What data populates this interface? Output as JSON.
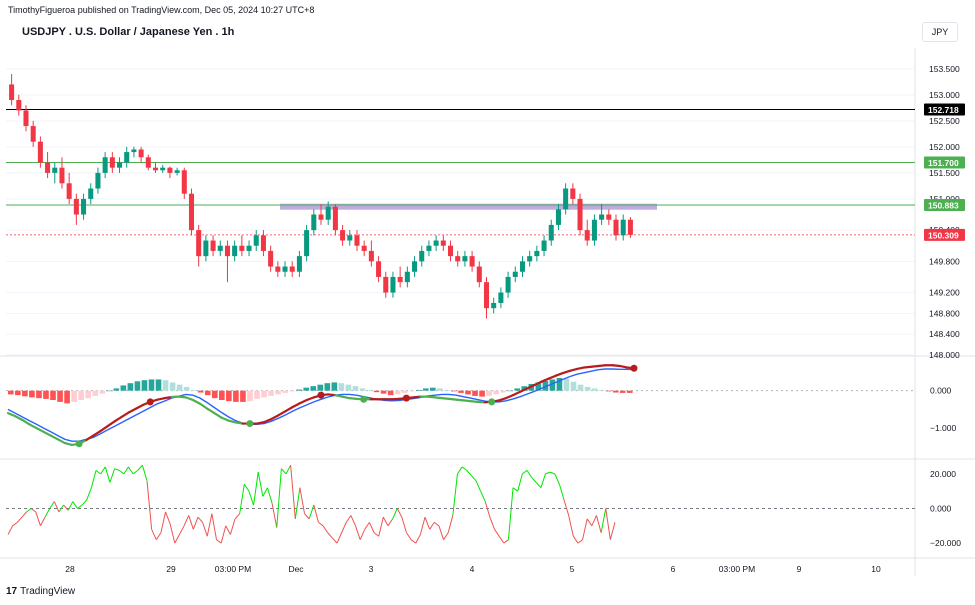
{
  "header": {
    "publisher": "TimothyFigueroa published on TradingView.com, Dec 05, 2024 10:27 UTC+8",
    "title": "USDJPY . U.S. Dollar / Japanese Yen . 1h",
    "currency": "JPY"
  },
  "footer": {
    "logo_glyph": "17",
    "logo_text": "TradingView"
  },
  "colors": {
    "up": "#089981",
    "down": "#f23645",
    "purple_zone": "#b39ddb",
    "green_line": "#4caf50",
    "black_line": "#000000",
    "price_line": "#f23645",
    "macd_line": "#2962ff",
    "signal_line_up": "#4caf50",
    "signal_line_down": "#b71c1c",
    "rsi_up": "#00e600",
    "rsi_down": "#ef5350"
  },
  "chart_data": {
    "type": "candlestick",
    "x_labels": [
      "28",
      "29",
      "03:00 PM",
      "Dec",
      "3",
      "4",
      "5",
      "6",
      "03:00 PM",
      "9",
      "10"
    ],
    "price_axis": {
      "ticks": [
        "153.500",
        "153.000",
        "152.500",
        "152.000",
        "151.500",
        "151.000",
        "150.400",
        "149.800",
        "149.200",
        "148.800",
        "148.400",
        "148.000"
      ],
      "range": [
        148.0,
        153.9
      ]
    },
    "horizontal_levels": [
      {
        "label": "152.718",
        "value": 152.718,
        "kind": "black"
      },
      {
        "label": "151.700",
        "value": 151.7,
        "kind": "green"
      },
      {
        "label": "150.883",
        "value": 150.883,
        "kind": "green"
      },
      {
        "label": "150.309",
        "value": 150.309,
        "kind": "price"
      }
    ],
    "resistance_zone": {
      "from_x": "Dec 2 ~02:00",
      "to_x": "Dec 5 ~20:00",
      "value": 150.85
    },
    "candles": [
      {
        "o": 153.2,
        "h": 153.4,
        "l": 152.8,
        "c": 152.9
      },
      {
        "o": 152.9,
        "h": 153.0,
        "l": 152.6,
        "c": 152.7
      },
      {
        "o": 152.7,
        "h": 152.8,
        "l": 152.3,
        "c": 152.4
      },
      {
        "o": 152.4,
        "h": 152.5,
        "l": 152.0,
        "c": 152.1
      },
      {
        "o": 152.1,
        "h": 152.2,
        "l": 151.6,
        "c": 151.7
      },
      {
        "o": 151.7,
        "h": 151.9,
        "l": 151.4,
        "c": 151.5
      },
      {
        "o": 151.5,
        "h": 151.7,
        "l": 151.3,
        "c": 151.6
      },
      {
        "o": 151.6,
        "h": 151.8,
        "l": 151.2,
        "c": 151.3
      },
      {
        "o": 151.3,
        "h": 151.5,
        "l": 150.9,
        "c": 151.0
      },
      {
        "o": 151.0,
        "h": 151.1,
        "l": 150.5,
        "c": 150.7
      },
      {
        "o": 150.7,
        "h": 151.1,
        "l": 150.6,
        "c": 151.0
      },
      {
        "o": 151.0,
        "h": 151.3,
        "l": 150.9,
        "c": 151.2
      },
      {
        "o": 151.2,
        "h": 151.6,
        "l": 151.1,
        "c": 151.5
      },
      {
        "o": 151.5,
        "h": 151.9,
        "l": 151.4,
        "c": 151.8
      },
      {
        "o": 151.8,
        "h": 151.9,
        "l": 151.5,
        "c": 151.6
      },
      {
        "o": 151.6,
        "h": 151.8,
        "l": 151.5,
        "c": 151.7
      },
      {
        "o": 151.7,
        "h": 152.0,
        "l": 151.6,
        "c": 151.9
      },
      {
        "o": 151.9,
        "h": 152.0,
        "l": 151.8,
        "c": 151.95
      },
      {
        "o": 151.95,
        "h": 152.0,
        "l": 151.7,
        "c": 151.8
      },
      {
        "o": 151.8,
        "h": 151.85,
        "l": 151.55,
        "c": 151.6
      },
      {
        "o": 151.6,
        "h": 151.7,
        "l": 151.5,
        "c": 151.55
      },
      {
        "o": 151.55,
        "h": 151.65,
        "l": 151.5,
        "c": 151.6
      },
      {
        "o": 151.6,
        "h": 151.62,
        "l": 151.4,
        "c": 151.5
      },
      {
        "o": 151.5,
        "h": 151.6,
        "l": 151.45,
        "c": 151.55
      },
      {
        "o": 151.55,
        "h": 151.6,
        "l": 151.0,
        "c": 151.1
      },
      {
        "o": 151.1,
        "h": 151.2,
        "l": 150.3,
        "c": 150.4
      },
      {
        "o": 150.4,
        "h": 150.5,
        "l": 149.7,
        "c": 149.9
      },
      {
        "o": 149.9,
        "h": 150.3,
        "l": 149.8,
        "c": 150.2
      },
      {
        "o": 150.2,
        "h": 150.3,
        "l": 149.9,
        "c": 150.0
      },
      {
        "o": 150.0,
        "h": 150.2,
        "l": 149.9,
        "c": 150.1
      },
      {
        "o": 150.1,
        "h": 150.2,
        "l": 149.4,
        "c": 149.9
      },
      {
        "o": 149.9,
        "h": 150.2,
        "l": 149.8,
        "c": 150.1
      },
      {
        "o": 150.1,
        "h": 150.3,
        "l": 149.9,
        "c": 150.0
      },
      {
        "o": 150.0,
        "h": 150.2,
        "l": 149.9,
        "c": 150.1
      },
      {
        "o": 150.1,
        "h": 150.4,
        "l": 150.0,
        "c": 150.3
      },
      {
        "o": 150.3,
        "h": 150.4,
        "l": 149.9,
        "c": 150.0
      },
      {
        "o": 150.0,
        "h": 150.1,
        "l": 149.6,
        "c": 149.7
      },
      {
        "o": 149.7,
        "h": 149.8,
        "l": 149.5,
        "c": 149.6
      },
      {
        "o": 149.6,
        "h": 149.8,
        "l": 149.5,
        "c": 149.7
      },
      {
        "o": 149.7,
        "h": 149.8,
        "l": 149.5,
        "c": 149.6
      },
      {
        "o": 149.6,
        "h": 150.0,
        "l": 149.5,
        "c": 149.9
      },
      {
        "o": 149.9,
        "h": 150.5,
        "l": 149.8,
        "c": 150.4
      },
      {
        "o": 150.4,
        "h": 150.8,
        "l": 150.3,
        "c": 150.7
      },
      {
        "o": 150.7,
        "h": 150.9,
        "l": 150.5,
        "c": 150.6
      },
      {
        "o": 150.6,
        "h": 150.95,
        "l": 150.5,
        "c": 150.85
      },
      {
        "o": 150.85,
        "h": 150.9,
        "l": 150.3,
        "c": 150.4
      },
      {
        "o": 150.4,
        "h": 150.5,
        "l": 150.1,
        "c": 150.2
      },
      {
        "o": 150.2,
        "h": 150.4,
        "l": 150.1,
        "c": 150.3
      },
      {
        "o": 150.3,
        "h": 150.4,
        "l": 150.0,
        "c": 150.1
      },
      {
        "o": 150.1,
        "h": 150.2,
        "l": 149.9,
        "c": 150.0
      },
      {
        "o": 150.0,
        "h": 150.2,
        "l": 149.7,
        "c": 149.8
      },
      {
        "o": 149.8,
        "h": 149.9,
        "l": 149.4,
        "c": 149.5
      },
      {
        "o": 149.5,
        "h": 149.6,
        "l": 149.1,
        "c": 149.2
      },
      {
        "o": 149.2,
        "h": 149.6,
        "l": 149.1,
        "c": 149.5
      },
      {
        "o": 149.5,
        "h": 149.7,
        "l": 149.3,
        "c": 149.4
      },
      {
        "o": 149.4,
        "h": 149.7,
        "l": 149.3,
        "c": 149.6
      },
      {
        "o": 149.6,
        "h": 149.9,
        "l": 149.5,
        "c": 149.8
      },
      {
        "o": 149.8,
        "h": 150.1,
        "l": 149.7,
        "c": 150.0
      },
      {
        "o": 150.0,
        "h": 150.2,
        "l": 149.9,
        "c": 150.1
      },
      {
        "o": 150.1,
        "h": 150.3,
        "l": 150.0,
        "c": 150.2
      },
      {
        "o": 150.2,
        "h": 150.3,
        "l": 150.0,
        "c": 150.1
      },
      {
        "o": 150.1,
        "h": 150.2,
        "l": 149.8,
        "c": 149.9
      },
      {
        "o": 149.9,
        "h": 150.0,
        "l": 149.7,
        "c": 149.8
      },
      {
        "o": 149.8,
        "h": 150.0,
        "l": 149.7,
        "c": 149.9
      },
      {
        "o": 149.9,
        "h": 150.0,
        "l": 149.6,
        "c": 149.7
      },
      {
        "o": 149.7,
        "h": 149.8,
        "l": 149.3,
        "c": 149.4
      },
      {
        "o": 149.4,
        "h": 149.5,
        "l": 148.7,
        "c": 148.9
      },
      {
        "o": 148.9,
        "h": 149.1,
        "l": 148.8,
        "c": 149.0
      },
      {
        "o": 149.0,
        "h": 149.3,
        "l": 148.9,
        "c": 149.2
      },
      {
        "o": 149.2,
        "h": 149.6,
        "l": 149.1,
        "c": 149.5
      },
      {
        "o": 149.5,
        "h": 149.7,
        "l": 149.4,
        "c": 149.6
      },
      {
        "o": 149.6,
        "h": 149.9,
        "l": 149.5,
        "c": 149.8
      },
      {
        "o": 149.8,
        "h": 150.0,
        "l": 149.7,
        "c": 149.9
      },
      {
        "o": 149.9,
        "h": 150.1,
        "l": 149.8,
        "c": 150.0
      },
      {
        "o": 150.0,
        "h": 150.3,
        "l": 149.9,
        "c": 150.2
      },
      {
        "o": 150.2,
        "h": 150.6,
        "l": 150.1,
        "c": 150.5
      },
      {
        "o": 150.5,
        "h": 150.9,
        "l": 150.4,
        "c": 150.8
      },
      {
        "o": 150.8,
        "h": 151.3,
        "l": 150.7,
        "c": 151.2
      },
      {
        "o": 151.2,
        "h": 151.3,
        "l": 150.9,
        "c": 151.0
      },
      {
        "o": 151.0,
        "h": 151.1,
        "l": 150.3,
        "c": 150.4
      },
      {
        "o": 150.4,
        "h": 150.6,
        "l": 150.1,
        "c": 150.2
      },
      {
        "o": 150.2,
        "h": 150.7,
        "l": 150.1,
        "c": 150.6
      },
      {
        "o": 150.6,
        "h": 150.9,
        "l": 150.5,
        "c": 150.7
      },
      {
        "o": 150.7,
        "h": 150.8,
        "l": 150.5,
        "c": 150.6
      },
      {
        "o": 150.6,
        "h": 150.7,
        "l": 150.2,
        "c": 150.3
      },
      {
        "o": 150.3,
        "h": 150.7,
        "l": 150.2,
        "c": 150.6
      },
      {
        "o": 150.6,
        "h": 150.65,
        "l": 150.25,
        "c": 150.31
      }
    ],
    "macd": {
      "ticks": [
        "0.000",
        "−1.000"
      ],
      "range": [
        -1.8,
        0.9
      ],
      "histogram": [
        -0.1,
        -0.12,
        -0.15,
        -0.18,
        -0.2,
        -0.22,
        -0.25,
        -0.3,
        -0.34,
        -0.3,
        -0.25,
        -0.2,
        -0.14,
        -0.08,
        0.0,
        0.06,
        0.14,
        0.2,
        0.25,
        0.28,
        0.3,
        0.3,
        0.28,
        0.22,
        0.16,
        0.1,
        0.02,
        -0.05,
        -0.12,
        -0.2,
        -0.25,
        -0.28,
        -0.3,
        -0.3,
        -0.28,
        -0.22,
        -0.18,
        -0.14,
        -0.1,
        -0.06,
        -0.02,
        0.03,
        0.08,
        0.12,
        0.16,
        0.2,
        0.22,
        0.2,
        0.16,
        0.12,
        0.06,
        0.02,
        -0.04,
        -0.08,
        -0.12,
        -0.1,
        -0.06,
        -0.02,
        0.02,
        0.06,
        0.08,
        0.06,
        0.02,
        -0.02,
        -0.06,
        -0.1,
        -0.14,
        -0.16,
        -0.14,
        -0.1,
        -0.05,
        0.0,
        0.06,
        0.12,
        0.18,
        0.22,
        0.26,
        0.3,
        0.34,
        0.32,
        0.24,
        0.16,
        0.1,
        0.06,
        0.02,
        -0.02,
        -0.05,
        -0.06,
        -0.06
      ],
      "macd_line": [
        -0.5,
        -0.6,
        -0.7,
        -0.8,
        -0.9,
        -1.0,
        -1.1,
        -1.2,
        -1.3,
        -1.35,
        -1.35,
        -1.3,
        -1.25,
        -1.15,
        -1.05,
        -0.95,
        -0.85,
        -0.75,
        -0.65,
        -0.55,
        -0.45,
        -0.35,
        -0.28,
        -0.2,
        -0.15,
        -0.1,
        -0.12,
        -0.2,
        -0.32,
        -0.45,
        -0.58,
        -0.7,
        -0.8,
        -0.87,
        -0.9,
        -0.9,
        -0.88,
        -0.82,
        -0.74,
        -0.65,
        -0.55,
        -0.46,
        -0.38,
        -0.3,
        -0.23,
        -0.17,
        -0.12,
        -0.1,
        -0.1,
        -0.12,
        -0.16,
        -0.2,
        -0.24,
        -0.26,
        -0.27,
        -0.26,
        -0.24,
        -0.21,
        -0.18,
        -0.14,
        -0.12,
        -0.1,
        -0.1,
        -0.12,
        -0.16,
        -0.2,
        -0.24,
        -0.28,
        -0.3,
        -0.3,
        -0.27,
        -0.22,
        -0.16,
        -0.09,
        -0.02,
        0.06,
        0.14,
        0.22,
        0.3,
        0.38,
        0.44,
        0.48,
        0.52,
        0.56,
        0.58,
        0.58,
        0.57,
        0.57,
        0.56
      ],
      "signal_line": [
        -0.6,
        -0.68,
        -0.78,
        -0.9,
        -1.0,
        -1.1,
        -1.2,
        -1.3,
        -1.4,
        -1.45,
        -1.42,
        -1.32,
        -1.2,
        -1.08,
        -0.95,
        -0.82,
        -0.7,
        -0.58,
        -0.48,
        -0.38,
        -0.3,
        -0.24,
        -0.2,
        -0.17,
        -0.16,
        -0.18,
        -0.25,
        -0.35,
        -0.48,
        -0.6,
        -0.72,
        -0.8,
        -0.85,
        -0.88,
        -0.88,
        -0.88,
        -0.84,
        -0.76,
        -0.66,
        -0.55,
        -0.44,
        -0.34,
        -0.25,
        -0.18,
        -0.12,
        -0.1,
        -0.12,
        -0.16,
        -0.2,
        -0.22,
        -0.23,
        -0.23,
        -0.23,
        -0.23,
        -0.23,
        -0.22,
        -0.2,
        -0.18,
        -0.16,
        -0.16,
        -0.18,
        -0.2,
        -0.22,
        -0.24,
        -0.26,
        -0.28,
        -0.3,
        -0.31,
        -0.3,
        -0.26,
        -0.2,
        -0.12,
        -0.03,
        0.06,
        0.15,
        0.24,
        0.32,
        0.4,
        0.47,
        0.53,
        0.58,
        0.62,
        0.64,
        0.66,
        0.68,
        0.68,
        0.66,
        0.62,
        0.6
      ],
      "cross_markers": [
        {
          "index": 10,
          "kind": "up"
        },
        {
          "index": 20,
          "kind": "down"
        },
        {
          "index": 34,
          "kind": "up"
        },
        {
          "index": 44,
          "kind": "down"
        },
        {
          "index": 50,
          "kind": "up"
        },
        {
          "index": 56,
          "kind": "down"
        },
        {
          "index": 68,
          "kind": "up"
        },
        {
          "index": 88,
          "kind": "down"
        }
      ]
    },
    "rsi_osc": {
      "ticks": [
        "20.000",
        "0.000",
        "−20.000"
      ],
      "range": [
        -28,
        28
      ],
      "values": [
        -15,
        -10,
        -8,
        -5,
        -2,
        0,
        -2,
        -10,
        -5,
        0,
        4,
        -2,
        2,
        -1,
        4,
        0,
        2,
        5,
        12,
        22,
        20,
        24,
        15,
        23,
        22,
        20,
        24,
        20,
        22,
        25,
        16,
        -12,
        -18,
        -14,
        -2,
        -9,
        -20,
        -15,
        -10,
        -4,
        -12,
        -5,
        -8,
        -16,
        -3,
        -18,
        -20,
        -10,
        -15,
        -6,
        -3,
        14,
        10,
        2,
        21,
        7,
        12,
        3,
        -11,
        23,
        20,
        25,
        -6,
        12,
        -3,
        -6,
        2,
        -8,
        -10,
        -14,
        -17,
        -20,
        -14,
        -8,
        -4,
        -10,
        -18,
        -12,
        -8,
        -14,
        -16,
        -5,
        -10,
        -6,
        0,
        -5,
        -14,
        -18,
        -20,
        -15,
        -5,
        -12,
        -8,
        -10,
        -18,
        -14,
        -4,
        20,
        24,
        22,
        19,
        16,
        10,
        4,
        -5,
        -12,
        -16,
        -20,
        -18,
        12,
        10,
        20,
        22,
        18,
        15,
        12,
        20,
        21,
        20,
        14,
        5,
        -4,
        -16,
        -20,
        -18,
        -6,
        -10,
        -4,
        -14,
        0,
        -18,
        -8
      ]
    }
  }
}
